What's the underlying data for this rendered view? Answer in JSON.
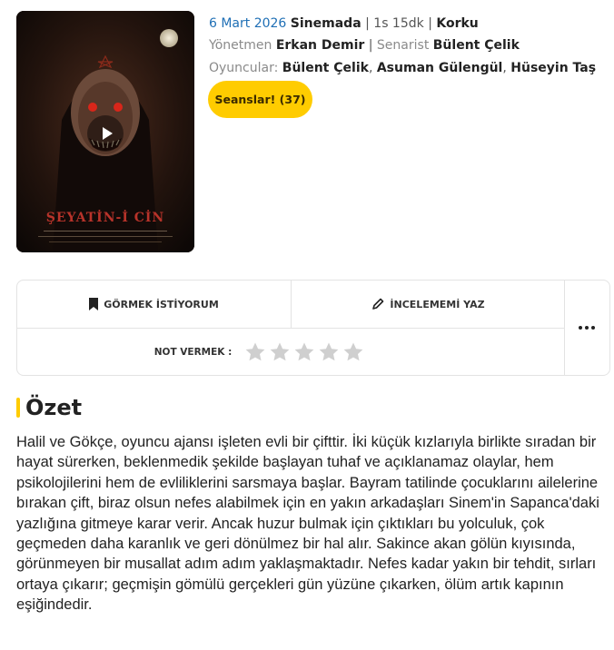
{
  "poster": {
    "title": "ŞEYATİN-İ CİN",
    "play_icon": "play-icon"
  },
  "meta": {
    "date": "6 Mart 2026",
    "status": "Sinemada",
    "duration": "1s 15dk",
    "genre": "Korku",
    "director_label": "Yönetmen",
    "director": "Erkan Demir",
    "writer_label": "Senarist",
    "writer": "Bülent Çelik",
    "cast_label": "Oyuncular:",
    "cast": [
      "Bülent Çelik",
      "Asuman Gülengül",
      "Hüseyin Taş"
    ]
  },
  "sessions_button": "Seanslar! (37)",
  "actions": {
    "want_to_watch": "GÖRMEK İSTİYORUM",
    "write_review": "İNCELEMEMİ YAZ",
    "rate_label": "NOT VERMEK :",
    "star_count": 5,
    "more_icon": "more-icon"
  },
  "summary": {
    "title": "Özet",
    "text": "Halil ve Gökçe, oyuncu ajansı işleten evli bir çifttir. İki küçük kızlarıyla birlikte sıradan bir hayat sürerken, beklenmedik şekilde başlayan tuhaf ve açıklanamaz olaylar, hem psikolojilerini hem de evliliklerini sarsmaya başlar. Bayram tatilinde çocuklarını ailelerine bırakan çift, biraz olsun nefes alabilmek için en yakın arkadaşları Sinem'in Sapanca'daki yazlığına gitmeye karar verir. Ancak huzur bulmak için çıktıkları bu yolculuk, çok geçmeden daha karanlık ve geri dönülmez bir hal alır. Sakince akan gölün kıyısında, görünmeyen bir musallat adım adım yaklaşmaktadır. Nefes kadar yakın bir tehdit, sırları ortaya çıkarır; geçmişin gömülü gerçekleri gün yüzüne çıkarken, ölüm artık kapının eşiğindedir."
  },
  "colors": {
    "accent": "#ffcc00",
    "date_blue": "#1f6fb5",
    "star_empty": "#cfcfcf"
  }
}
